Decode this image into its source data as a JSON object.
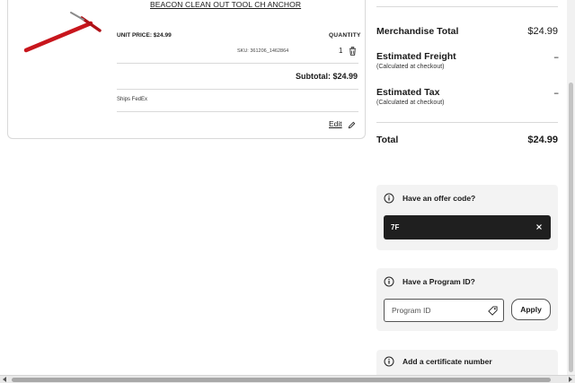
{
  "cart_item": {
    "title": "BEACON CLEAN OUT TOOL CH ANCHOR",
    "unit_price": "UNIT PRICE: $24.99",
    "quantity_label": "QUANTITY",
    "sku": "SKU: 361206_1462864",
    "quantity": "1",
    "subtotal": "Subtotal: $24.99",
    "shipping": "Ships FedEx",
    "edit_label": "Edit",
    "image_icon": "red-t-handle-tool",
    "trash_icon": "trash-icon",
    "edit_icon": "pencil-icon"
  },
  "summary": {
    "merch_label": "Merchandise Total",
    "merch_value": "$24.99",
    "freight_label": "Estimated Freight",
    "freight_note": "(Calculated at checkout)",
    "freight_value": "--",
    "tax_label": "Estimated Tax",
    "tax_note": "(Calculated at checkout)",
    "tax_value": "--",
    "total_label": "Total",
    "total_value": "$24.99"
  },
  "offer": {
    "title": "Have an offer code?",
    "value": "7F",
    "icon": "info-icon"
  },
  "program": {
    "title": "Have a Program ID?",
    "placeholder": "Program ID",
    "apply_label": "Apply",
    "icon": "tag-icon"
  },
  "certificate": {
    "title": "Add a certificate number"
  },
  "colors": {
    "accent_red": "#c8161d",
    "offer_field_bg": "#1f1f1f",
    "panel_bg": "#f3f3f3"
  }
}
